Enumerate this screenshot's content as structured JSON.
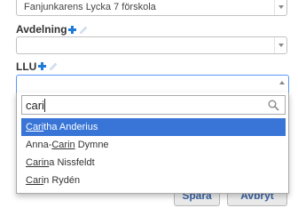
{
  "form": {
    "school_select": {
      "value": "Fanjunkarens Lycka 7 förskola"
    },
    "avdelning": {
      "label": "Avdelning",
      "value": ""
    },
    "llu": {
      "label": "LLU",
      "value": ""
    }
  },
  "dropdown": {
    "search_value": "cari",
    "options": [
      {
        "before": "",
        "match": "Cari",
        "after": "tha Anderius",
        "highlighted": true
      },
      {
        "before": "Anna-",
        "match": "Carin",
        "after": " Dymne",
        "highlighted": false
      },
      {
        "before": "",
        "match": "Carin",
        "after": "a Nissfeldt",
        "highlighted": false
      },
      {
        "before": "",
        "match": "Cari",
        "after": "n Rydén",
        "highlighted": false
      }
    ]
  },
  "buttons": {
    "save_label": "Spara",
    "cancel_label": "Avbryt"
  },
  "colors": {
    "accent": "#1f7bd6",
    "highlight": "#3875d7",
    "button_text": "#3a66a8"
  },
  "icons": {
    "add": "plus-icon",
    "edit": "pencil-icon",
    "search": "search-icon",
    "dropdown_arrow": "chevron-down-icon"
  }
}
